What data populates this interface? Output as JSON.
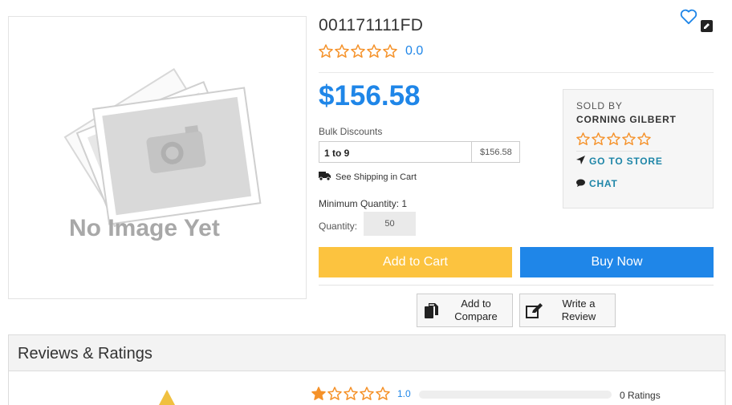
{
  "product": {
    "sku": "001171111FD",
    "rating_value": "0.0",
    "rating_stars": 0,
    "price": "$156.58",
    "image_placeholder": "No Image Yet",
    "bulk": {
      "label": "Bulk Discounts",
      "rows": [
        {
          "range": "1 to 9",
          "price": "$156.58"
        }
      ]
    },
    "shipping_text": "See Shipping in Cart",
    "min_quantity": "Minimum Quantity: 1",
    "quantity_label": "Quantity:",
    "quantity_value": "50"
  },
  "actions": {
    "add_to_cart": "Add to Cart",
    "buy_now": "Buy Now",
    "add_to_compare": "Add to\nCompare",
    "write_review": "Write a\nReview"
  },
  "seller": {
    "sold_by_label": "SOLD BY",
    "name": "CORNING GILBERT",
    "rating_stars": 0,
    "go_to_store": "GO TO STORE",
    "chat": "CHAT"
  },
  "reviews": {
    "title": "Reviews & Ratings",
    "row": {
      "stars": 1,
      "value": "1.0",
      "fill_fraction": 0,
      "count_text": "0 Ratings"
    }
  },
  "colors": {
    "accent_blue": "#1f86e8",
    "star_orange": "#f5922a",
    "cart_yellow": "#fcc33f",
    "seller_link": "#1f86a8"
  },
  "icons": [
    "heart-icon",
    "edit-icon",
    "truck-icon",
    "copy-icon",
    "pencil-square-icon",
    "location-arrow-icon",
    "chat-bubble-icon",
    "star-icon",
    "warning-icon"
  ]
}
